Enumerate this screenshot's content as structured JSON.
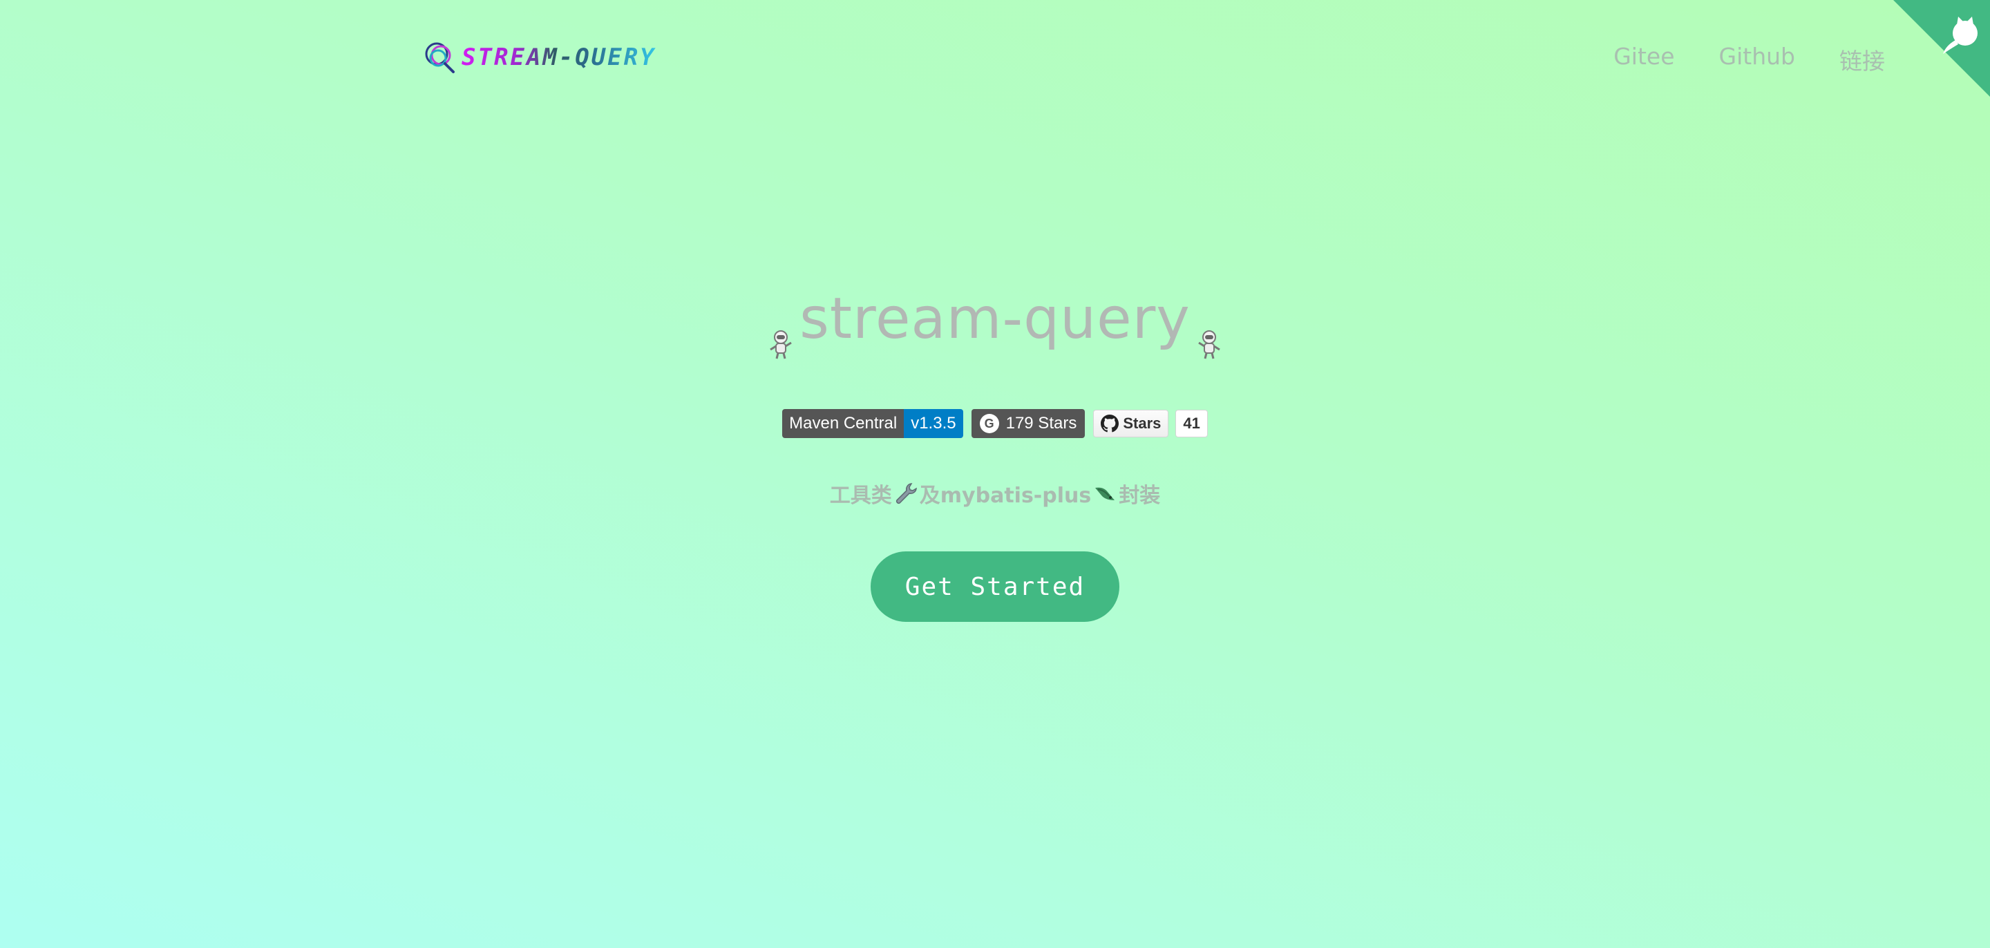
{
  "header": {
    "logo_text": "STREAM-QUERY",
    "nav": [
      {
        "label": "Gitee"
      },
      {
        "label": "Github"
      },
      {
        "label": "链接"
      }
    ]
  },
  "hero": {
    "title": "stream-query",
    "badges": {
      "maven": {
        "label": "Maven Central",
        "value": "v1.3.5"
      },
      "gitee": {
        "text": "179 Stars"
      },
      "github": {
        "label": "Stars",
        "count": "41"
      }
    },
    "tagline": {
      "part1": "工具类",
      "part2": "及mybatis-plus",
      "part3": "封装"
    },
    "cta_label": "Get Started"
  },
  "colors": {
    "accent": "#42b983",
    "nav_text": "#a9bfb0",
    "title_text": "#b2b8b4",
    "background_top": "#b4fdb6",
    "background_bottom": "#aefff1"
  },
  "icons": {
    "corner": "github-corner-icon",
    "title_decor": "astronaut-icon",
    "tagline_1": "wrench-icon",
    "tagline_2": "bird-icon",
    "gitee_badge": "gitee-logo-icon",
    "github_badge": "github-logo-icon"
  }
}
